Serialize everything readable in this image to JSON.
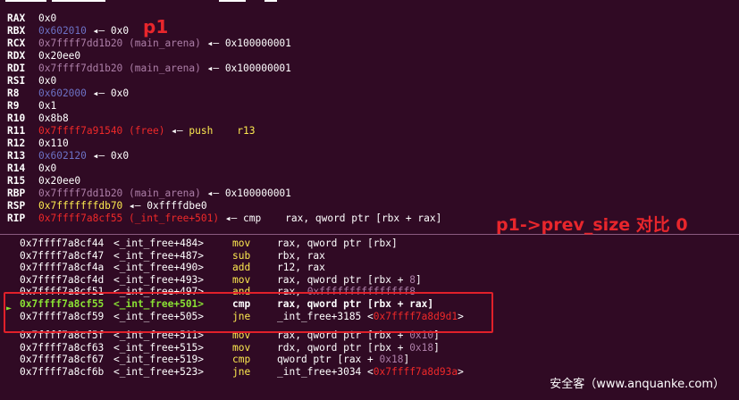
{
  "registers": [
    {
      "name": "RAX",
      "parts": [
        {
          "t": "0x0",
          "c": "wt"
        }
      ]
    },
    {
      "name": "RBX",
      "parts": [
        {
          "t": "0x602010",
          "c": "bl"
        },
        {
          "t": " ◂— ",
          "c": "wt"
        },
        {
          "t": "0x0",
          "c": "wt"
        }
      ]
    },
    {
      "name": "RCX",
      "parts": [
        {
          "t": "0x7ffff7dd1b20 (main_arena)",
          "c": "pu"
        },
        {
          "t": " ◂— ",
          "c": "wt"
        },
        {
          "t": "0x100000001",
          "c": "wt"
        }
      ]
    },
    {
      "name": "RDX",
      "parts": [
        {
          "t": "0x20ee0",
          "c": "wt"
        }
      ]
    },
    {
      "name": "RDI",
      "parts": [
        {
          "t": "0x7ffff7dd1b20 (main_arena)",
          "c": "pu"
        },
        {
          "t": " ◂— ",
          "c": "wt"
        },
        {
          "t": "0x100000001",
          "c": "wt"
        }
      ]
    },
    {
      "name": "RSI",
      "parts": [
        {
          "t": "0x0",
          "c": "wt"
        }
      ]
    },
    {
      "name": "R8",
      "parts": [
        {
          "t": "0x602000",
          "c": "bl"
        },
        {
          "t": " ◂— ",
          "c": "wt"
        },
        {
          "t": "0x0",
          "c": "wt"
        }
      ]
    },
    {
      "name": "R9",
      "parts": [
        {
          "t": "0x1",
          "c": "wt"
        }
      ]
    },
    {
      "name": "R10",
      "parts": [
        {
          "t": "0x8b8",
          "c": "wt"
        }
      ]
    },
    {
      "name": "R11",
      "parts": [
        {
          "t": "0x7ffff7a91540 (free)",
          "c": "rd"
        },
        {
          "t": " ◂— ",
          "c": "wt"
        },
        {
          "t": "push    r13",
          "c": "yl"
        }
      ]
    },
    {
      "name": "R12",
      "parts": [
        {
          "t": "0x110",
          "c": "wt"
        }
      ]
    },
    {
      "name": "R13",
      "parts": [
        {
          "t": "0x602120",
          "c": "bl"
        },
        {
          "t": " ◂— ",
          "c": "wt"
        },
        {
          "t": "0x0",
          "c": "wt"
        }
      ]
    },
    {
      "name": "R14",
      "parts": [
        {
          "t": "0x0",
          "c": "wt"
        }
      ]
    },
    {
      "name": "R15",
      "parts": [
        {
          "t": "0x20ee0",
          "c": "wt"
        }
      ]
    },
    {
      "name": "RBP",
      "parts": [
        {
          "t": "0x7ffff7dd1b20 (main_arena)",
          "c": "pu"
        },
        {
          "t": " ◂— ",
          "c": "wt"
        },
        {
          "t": "0x100000001",
          "c": "wt"
        }
      ]
    },
    {
      "name": "RSP",
      "parts": [
        {
          "t": "0x7fffffffdb70",
          "c": "yl"
        },
        {
          "t": " ◂— ",
          "c": "wt"
        },
        {
          "t": "0xffffdbe0",
          "c": "wt"
        }
      ]
    },
    {
      "name": "RIP",
      "parts": [
        {
          "t": "0x7ffff7a8cf55 (_int_free+501)",
          "c": "rd"
        },
        {
          "t": " ◂— ",
          "c": "wt"
        },
        {
          "t": "cmp    rax, qword ptr [rbx + rax]",
          "c": "wt"
        }
      ]
    }
  ],
  "disasm": [
    {
      "addr": "0x7ffff7a8cf44",
      "sym": "<_int_free+484>",
      "mn": "mov",
      "ops": [
        {
          "t": "rax, qword ptr [rbx]",
          "c": "wt"
        }
      ]
    },
    {
      "addr": "0x7ffff7a8cf47",
      "sym": "<_int_free+487>",
      "mn": "sub",
      "ops": [
        {
          "t": "rbx, rax",
          "c": "wt"
        }
      ]
    },
    {
      "addr": "0x7ffff7a8cf4a",
      "sym": "<_int_free+490>",
      "mn": "add",
      "ops": [
        {
          "t": "r12, rax",
          "c": "wt"
        }
      ]
    },
    {
      "addr": "0x7ffff7a8cf4d",
      "sym": "<_int_free+493>",
      "mn": "mov",
      "ops": [
        {
          "t": "rax, qword ptr [rbx + ",
          "c": "wt"
        },
        {
          "t": "8",
          "c": "pu"
        },
        {
          "t": "]",
          "c": "wt"
        }
      ]
    },
    {
      "addr": "0x7ffff7a8cf51",
      "sym": "<_int_free+497>",
      "mn": "and",
      "ops": [
        {
          "t": "rax, ",
          "c": "wt"
        },
        {
          "t": "0xfffffffffffffff8",
          "c": "pu"
        }
      ]
    },
    {
      "addr": "0x7ffff7a8cf55",
      "sym": "<_int_free+501>",
      "mn": "cmp",
      "ops": [
        {
          "t": "rax, qword ptr [rbx + rax]",
          "c": "wt"
        }
      ],
      "current": true
    },
    {
      "addr": "0x7ffff7a8cf59",
      "sym": "<_int_free+505>",
      "mn": "jne",
      "ops": [
        {
          "t": "_int_free+3185",
          "c": "wt"
        },
        {
          "t": " <",
          "c": "wt"
        },
        {
          "t": "0x7ffff7a8d9d1",
          "c": "rd"
        },
        {
          "t": ">",
          "c": "wt"
        }
      ]
    },
    {
      "gap": true
    },
    {
      "addr": "0x7ffff7a8cf5f",
      "sym": "<_int_free+511>",
      "mn": "mov",
      "ops": [
        {
          "t": "rax, qword ptr [rbx + ",
          "c": "wt"
        },
        {
          "t": "0x10",
          "c": "pu"
        },
        {
          "t": "]",
          "c": "wt"
        }
      ]
    },
    {
      "addr": "0x7ffff7a8cf63",
      "sym": "<_int_free+515>",
      "mn": "mov",
      "ops": [
        {
          "t": "rdx, qword ptr [rbx + ",
          "c": "wt"
        },
        {
          "t": "0x18",
          "c": "pu"
        },
        {
          "t": "]",
          "c": "wt"
        }
      ]
    },
    {
      "addr": "0x7ffff7a8cf67",
      "sym": "<_int_free+519>",
      "mn": "cmp",
      "ops": [
        {
          "t": "qword ptr [rax + ",
          "c": "wt"
        },
        {
          "t": "0x18",
          "c": "pu"
        },
        {
          "t": "]",
          "c": "wt"
        }
      ]
    },
    {
      "addr": "0x7ffff7a8cf6b",
      "sym": "<_int_free+523>",
      "mn": "jne",
      "ops": [
        {
          "t": "_int_free+3034",
          "c": "wt"
        },
        {
          "t": " <",
          "c": "wt"
        },
        {
          "t": "0x7ffff7a8d93a",
          "c": "rd"
        },
        {
          "t": ">",
          "c": "wt"
        }
      ]
    }
  ],
  "annotations": {
    "p1": "p1",
    "compare": "p1->prev_size 对比 0"
  },
  "current_marker": "►",
  "watermark": "安全客（www.anquanke.com）",
  "colors": {
    "background": "#300a24",
    "highlight_box": "#e0202a",
    "annotation": "#e8262c"
  }
}
